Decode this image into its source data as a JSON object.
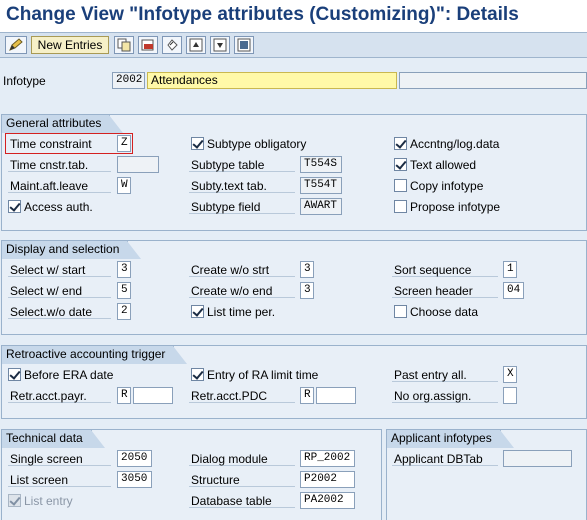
{
  "title": "Change View \"Infotype attributes (Customizing)\": Details",
  "toolbar": {
    "new_entries_label": "New Entries",
    "icons": [
      "change-display-icon",
      "copy-icon",
      "delete-icon",
      "undo-icon",
      "previous-entry-icon",
      "next-entry-icon",
      "select-all-icon"
    ]
  },
  "header": {
    "infotype_label": "Infotype",
    "infotype_value": "2002",
    "infotype_text": "Attendances"
  },
  "general": {
    "title": "General attributes",
    "time_constraint_label": "Time constraint",
    "time_constraint_value": "Z",
    "time_cnstr_tab_label": "Time cnstr.tab.",
    "time_cnstr_tab_value": "",
    "maint_aft_leave_label": "Maint.aft.leave",
    "maint_aft_leave_value": "W",
    "access_auth_label": "Access auth.",
    "access_auth_checked": true,
    "subtype_obligatory_label": "Subtype obligatory",
    "subtype_obligatory_checked": true,
    "subtype_table_label": "Subtype table",
    "subtype_table_value": "T554S",
    "subty_text_tab_label": "Subty.text tab.",
    "subty_text_tab_value": "T554T",
    "subtype_field_label": "Subtype field",
    "subtype_field_value": "AWART",
    "accntng_label": "Accntng/log.data",
    "accntng_checked": true,
    "text_allowed_label": "Text allowed",
    "text_allowed_checked": true,
    "copy_infotype_label": "Copy infotype",
    "copy_infotype_checked": false,
    "propose_infotype_label": "Propose infotype",
    "propose_infotype_checked": false
  },
  "display": {
    "title": "Display and selection",
    "select_start_label": "Select w/ start",
    "select_start_value": "3",
    "select_end_label": "Select w/ end",
    "select_end_value": "5",
    "select_wo_date_label": "Select.w/o date",
    "select_wo_date_value": "2",
    "create_wo_strt_label": "Create w/o strt",
    "create_wo_strt_value": "3",
    "create_wo_end_label": "Create w/o end",
    "create_wo_end_value": "3",
    "list_time_per_label": "List time per.",
    "list_time_per_checked": true,
    "sort_sequence_label": "Sort sequence",
    "sort_sequence_value": "1",
    "screen_header_label": "Screen header",
    "screen_header_value": "04",
    "choose_data_label": "Choose data",
    "choose_data_checked": false
  },
  "retro": {
    "title": "Retroactive accounting trigger",
    "before_era_label": "Before ERA date",
    "before_era_checked": true,
    "retr_payr_label": "Retr.acct.payr.",
    "retr_payr_value": "R",
    "retr_payr_value2": "",
    "entry_ra_label": "Entry of RA limit time",
    "entry_ra_checked": true,
    "retr_pdc_label": "Retr.acct.PDC",
    "retr_pdc_value": "R",
    "retr_pdc_value2": "",
    "past_entry_label": "Past entry all.",
    "past_entry_value": "X",
    "no_org_label": "No org.assign.",
    "no_org_value": ""
  },
  "technical": {
    "title": "Technical data",
    "single_screen_label": "Single screen",
    "single_screen_value": "2050",
    "list_screen_label": "List screen",
    "list_screen_value": "3050",
    "list_entry_label": "List entry",
    "list_entry_checked": true,
    "dialog_module_label": "Dialog module",
    "dialog_module_value": "RP_2002",
    "structure_label": "Structure",
    "structure_value": "P2002",
    "database_table_label": "Database table",
    "database_table_value": "PA2002"
  },
  "applicant": {
    "title": "Applicant infotypes",
    "dbtab_label": "Applicant DBTab",
    "dbtab_value": ""
  },
  "colors": {
    "title_text": "#1a3f7a",
    "background": "#e4edf6",
    "highlight_field": "#fff9a8",
    "focus_border": "#d42020"
  }
}
